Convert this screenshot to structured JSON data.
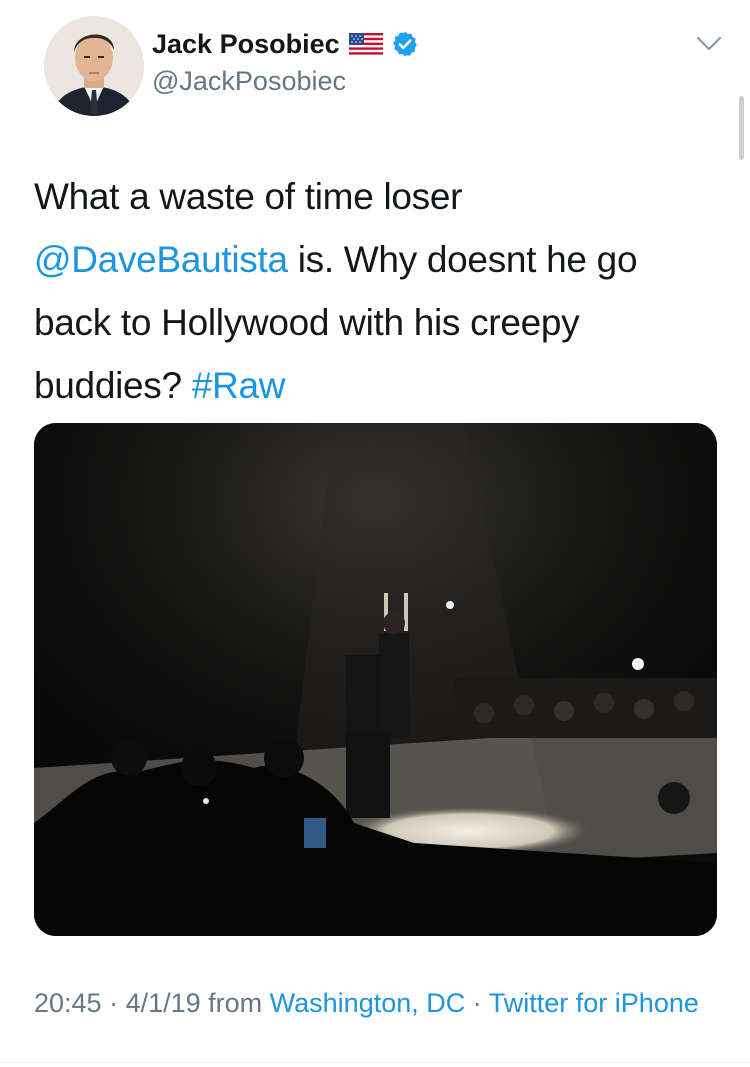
{
  "tweet": {
    "author_name": "Jack Posobiec",
    "handle": "@JackPosobiec",
    "flag_icon": "us-flag-icon",
    "verified_icon": "verified-badge-icon",
    "text": {
      "line1": "What a waste of time loser",
      "mention": "@DaveBautista",
      "after_mention": " is. Why doesnt he go back to Hollywood with his creepy buddies? ",
      "hashtag": "#Raw"
    },
    "media": {
      "type": "photo"
    },
    "meta": {
      "time": "20:45",
      "separator1": " · ",
      "date": "4/1/19",
      "from_label": " from ",
      "location": "Washington, DC",
      "separator2": " · ",
      "source": "Twitter for iPhone"
    }
  },
  "colors": {
    "link": "#1b95e0",
    "verified": "#1da1f2",
    "secondary_text": "#657786",
    "primary_text": "#14171a"
  }
}
